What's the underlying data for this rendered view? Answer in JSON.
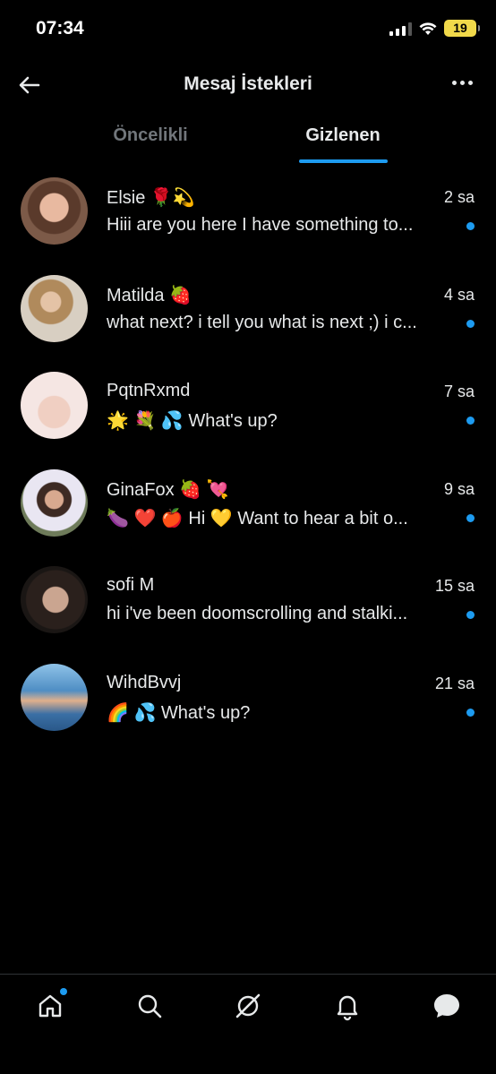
{
  "status": {
    "time": "07:34",
    "battery": "19"
  },
  "header": {
    "title": "Mesaj İstekleri"
  },
  "tabs": [
    {
      "label": "Öncelikli",
      "active": false
    },
    {
      "label": "Gizlenen",
      "active": true
    }
  ],
  "conversations": [
    {
      "name": "Elsie 🌹💫",
      "time": "2 sa",
      "preview": "Hiii are you here I have something to...",
      "unread": true
    },
    {
      "name": "Matilda 🍓",
      "time": "4 sa",
      "preview": "what next? i tell you what is next ;) i c...",
      "unread": true
    },
    {
      "name": "PqtnRxmd",
      "time": "7 sa",
      "preview": "🌟 💐 💦 What's up?",
      "unread": true
    },
    {
      "name": "GinaFox 🍓 💘",
      "time": "9 sa",
      "preview": "🍆 ❤️ 🍎 Hi 💛 Want to hear a bit o...",
      "unread": true
    },
    {
      "name": "sofi M",
      "time": "15 sa",
      "preview": "hi i've been doomscrolling and stalki...",
      "unread": true
    },
    {
      "name": "WihdBvvj",
      "time": "21 sa",
      "preview": "🌈 💦 What's up?",
      "unread": true
    }
  ],
  "colors": {
    "accent": "#1d9bf0",
    "background": "#000000",
    "text": "#e7e9ea",
    "muted": "#71767b"
  },
  "bottom_nav": [
    "home-icon",
    "search-icon",
    "grok-icon",
    "notifications-icon",
    "messages-icon"
  ]
}
